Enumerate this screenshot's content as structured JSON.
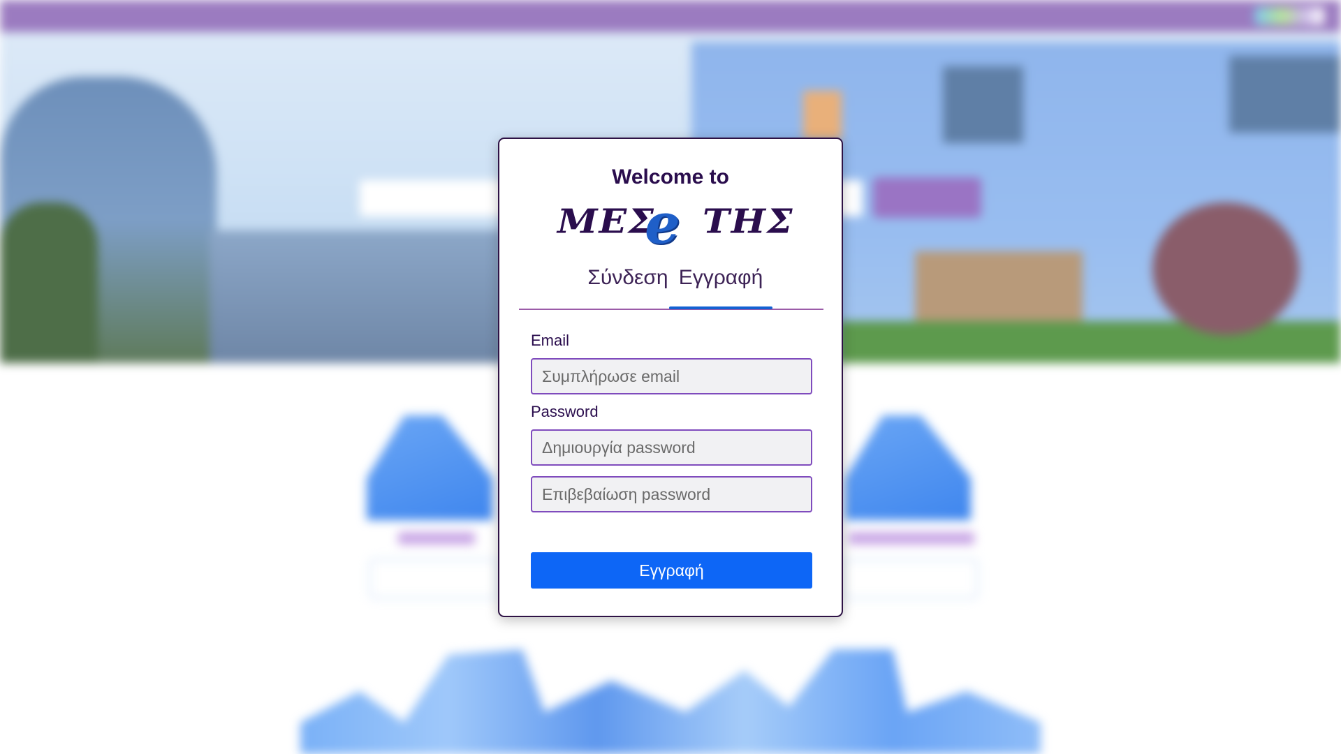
{
  "modal": {
    "welcome": "Welcome to",
    "logo": {
      "left": "ΜΕΣ",
      "middle": "e",
      "right": "ΤΗΣ"
    },
    "tabs": [
      {
        "label": "Σύνδεση",
        "active": false
      },
      {
        "label": "Εγγραφή",
        "active": true
      }
    ],
    "form": {
      "email_label": "Email",
      "email_placeholder": "Συμπλήρωσε email",
      "password_label": "Password",
      "password_placeholder": "Δημιουργία password",
      "confirm_placeholder": "Επιβεβαίωση password",
      "submit_label": "Εγγραφή"
    }
  },
  "colors": {
    "brand_purple": "#2a0d4d",
    "accent_blue": "#0d66f6",
    "input_border": "#7f4bbd",
    "topbar": "#9b7bc0"
  }
}
